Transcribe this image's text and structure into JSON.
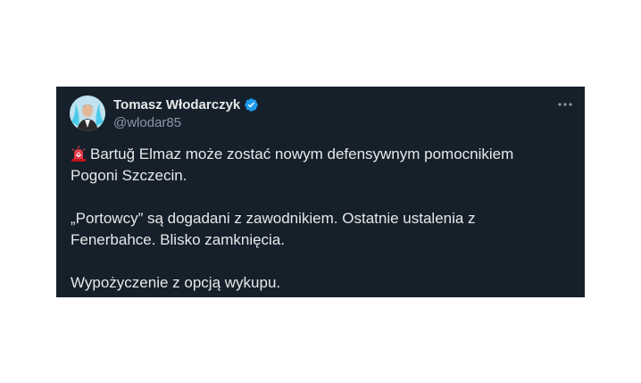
{
  "tweet": {
    "author": {
      "display_name": "Tomasz Włodarczyk",
      "handle": "@wlodar85",
      "verified": true,
      "avatar_icon": "avatar-photo"
    },
    "more_icon": "more-horizontal-icon",
    "emoji": "police-car-light",
    "paragraphs": [
      {
        "line1": "Bartuğ Elmaz może zostać nowym defensywnym pomocnikiem",
        "line2": "Pogoni Szczecin."
      },
      {
        "line1": "„Portowcy” są dogadani z zawodnikiem. Ostatnie ustalenia z",
        "line2": "Fenerbahce. Blisko zamknięcia."
      },
      {
        "line1": "Wypożyczenie z opcją wykupu."
      }
    ]
  },
  "colors": {
    "card_background": "#15202b",
    "text": "#e7e9ea",
    "secondary_text": "#8b98a5",
    "verified_blue": "#1d9bf0"
  }
}
